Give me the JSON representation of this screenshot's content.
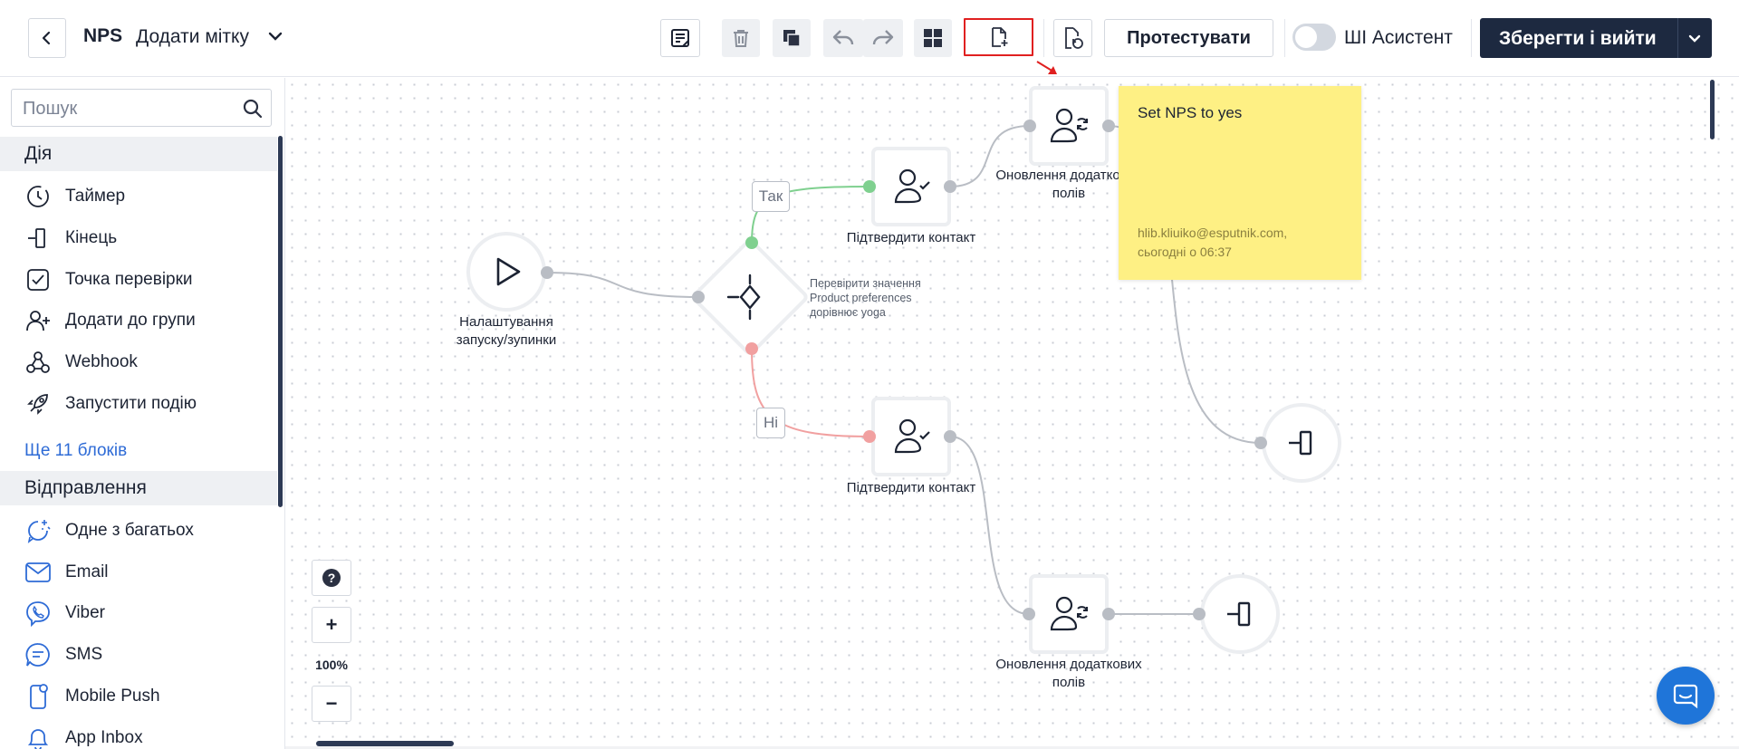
{
  "header": {
    "title": "NPS",
    "subtitle": "Додати мітку",
    "test_label": "Протестувати",
    "ai_assistant_label": "ШІ Асистент",
    "ai_assistant_enabled": false,
    "save_label": "Зберегти і вийти"
  },
  "toolbar": {
    "icons": [
      "notes-icon",
      "trash-icon",
      "copy-icon",
      "undo-icon",
      "redo-icon",
      "grid-icon",
      "add-file-icon",
      "restore-file-icon"
    ]
  },
  "sidebar": {
    "search_placeholder": "Пошук",
    "sections": [
      {
        "title": "Дія",
        "items": [
          {
            "label": "Таймер",
            "icon": "timer-icon"
          },
          {
            "label": "Кінець",
            "icon": "end-icon"
          },
          {
            "label": "Точка перевірки",
            "icon": "checkpoint-icon"
          },
          {
            "label": "Додати до групи",
            "icon": "add-to-group-icon"
          },
          {
            "label": "Webhook",
            "icon": "webhook-icon"
          },
          {
            "label": "Запустити подію",
            "icon": "rocket-icon"
          }
        ],
        "more": "Ще 11 блоків"
      },
      {
        "title": "Відправлення",
        "items": [
          {
            "label": "Одне з багатьох",
            "icon": "one-of-many-icon"
          },
          {
            "label": "Email",
            "icon": "email-icon"
          },
          {
            "label": "Viber",
            "icon": "viber-icon"
          },
          {
            "label": "SMS",
            "icon": "sms-icon"
          },
          {
            "label": "Mobile Push",
            "icon": "mobile-push-icon"
          },
          {
            "label": "App Inbox",
            "icon": "app-inbox-icon"
          }
        ]
      }
    ]
  },
  "canvas": {
    "start_node": {
      "label_line1": "Налаштування",
      "label_line2": "запуску/зупинки"
    },
    "condition_node": {
      "line1": "Перевірити значення",
      "line2": "Product preferences",
      "line3": "дорівнює yoga"
    },
    "branch_yes": "Так",
    "branch_no": "Ні",
    "confirm_contact_1": "Підтвердити контакт",
    "confirm_contact_2": "Підтвердити контакт",
    "update_fields_1": {
      "line1": "Оновлення додаткових",
      "line2": "полів"
    },
    "update_fields_2": {
      "line1": "Оновлення додаткових",
      "line2": "полів"
    },
    "sticky_note": {
      "text": "Set NPS to yes",
      "author": "hlib.kliuiko@esputnik.com,",
      "time": "сьогодні о 06:37",
      "color": "#fef084"
    },
    "zoom": {
      "plus": "+",
      "value": "100%",
      "minus": "−"
    }
  },
  "colors": {
    "primary_dark": "#1d2940",
    "link": "#2e6bd6",
    "yes_branch": "#7fd08f",
    "no_branch": "#f1a0a0",
    "highlight": "#e02020",
    "chat": "#1f75d9"
  }
}
